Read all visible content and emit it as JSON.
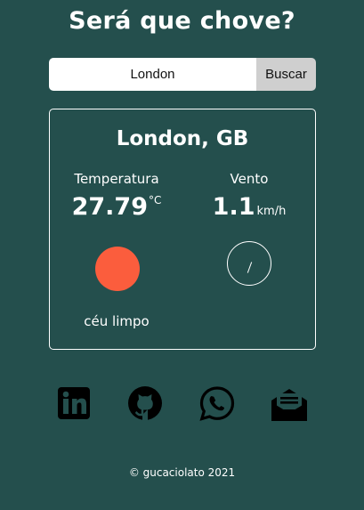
{
  "header": {
    "title": "Será que chove?"
  },
  "search": {
    "value": "London",
    "button_label": "Buscar"
  },
  "weather": {
    "city": "London, GB",
    "temperature_label": "Temperatura",
    "temperature_value": "27.79",
    "temperature_unit": "°C",
    "wind_label": "Vento",
    "wind_value": "1.1",
    "wind_unit": "km/h",
    "condition": "céu limpo",
    "condition_icon": "sun-icon",
    "wind_icon": "compass-icon"
  },
  "social": [
    {
      "icon": "linkedin-icon"
    },
    {
      "icon": "github-icon"
    },
    {
      "icon": "whatsapp-icon"
    },
    {
      "icon": "mail-icon"
    }
  ],
  "footer": {
    "text": "© gucaciolato 2021"
  },
  "colors": {
    "background": "#244f4d",
    "sun": "#fb5d3d",
    "button": "#cfcfcf"
  }
}
